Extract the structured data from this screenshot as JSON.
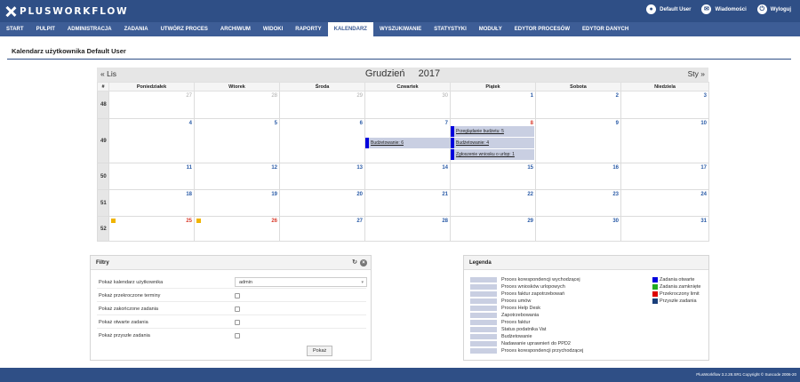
{
  "app": {
    "logo": "PLUSWORKFLOW"
  },
  "user_links": [
    {
      "label": "Default User",
      "icon": "user-icon",
      "glyph": "●"
    },
    {
      "label": "Wiadomości",
      "icon": "mail-icon",
      "glyph": "✉"
    },
    {
      "label": "Wyloguj",
      "icon": "power-icon",
      "glyph": "⏻"
    }
  ],
  "nav": [
    "START",
    "PULPIT",
    "ADMINISTRACJA",
    "ZADANIA",
    "UTWÓRZ PROCES",
    "ARCHIWUM",
    "WIDOKI",
    "RAPORTY",
    "KALENDARZ",
    "WYSZUKIWANIE",
    "STATYSTYKI",
    "MODUŁY",
    "EDYTOR PROCESÓW",
    "EDYTOR DANYCH"
  ],
  "active_nav": "KALENDARZ",
  "page_title": "Kalendarz użytkownika Default User",
  "calendar": {
    "prev": "« Lis",
    "next": "Sty »",
    "month": "Grudzień",
    "year": "2017",
    "headers": [
      "#",
      "Poniedziałek",
      "Wtorek",
      "Środa",
      "Czwartek",
      "Piątek",
      "Sobota",
      "Niedziela"
    ],
    "weeks": [
      {
        "num": "48",
        "days": [
          "27",
          "28",
          "29",
          "30",
          "1",
          "2",
          "3"
        ]
      },
      {
        "num": "49",
        "days": [
          "4",
          "5",
          "6",
          "7",
          "8",
          "9",
          "10"
        ]
      },
      {
        "num": "50",
        "days": [
          "11",
          "12",
          "13",
          "14",
          "15",
          "16",
          "17"
        ]
      },
      {
        "num": "51",
        "days": [
          "18",
          "19",
          "20",
          "21",
          "22",
          "23",
          "24"
        ]
      },
      {
        "num": "52",
        "days": [
          "25",
          "26",
          "27",
          "28",
          "29",
          "30",
          "31"
        ]
      }
    ],
    "events": {
      "budzetowanie_6": "Budżetowanie: 6",
      "przegladanie_5": "Przeglądanie budżetu: 5",
      "budzetowanie_4": "Budżetowanie: 4",
      "urlop_1": "Zgłoszenie wniosku o urlop: 1"
    },
    "event_color": "#0000dd"
  },
  "filters": {
    "title": "Filtry",
    "calendar_label": "Pokaż kalendarz użytkownika",
    "calendar_value": "admin",
    "overdue_label": "Pokaż przekroczone terminy",
    "finished_label": "Pokaż zakończone zadania",
    "open_label": "Pokaż otwarte zadania",
    "future_label": "Pokaż przyszłe zadania",
    "show_button": "Pokaż"
  },
  "legend": {
    "title": "Legenda",
    "processes": [
      "Proces korespondencji wychodzącej",
      "Proces wniosków urlopowych",
      "Proces faktur zapotrzebowań",
      "Proces umów",
      "Proces Help Desk",
      "Zapotrzebowania",
      "Proces faktur",
      "Status podatnika Vat",
      "Budżetowanie",
      "Nadawanie uprawnień do PPD2",
      "Proces korespondencji przychodzącej"
    ],
    "statuses": [
      {
        "label": "Zadania otwarte",
        "color": "#0000dd"
      },
      {
        "label": "Zadania zamknięte",
        "color": "#22aa22"
      },
      {
        "label": "Przekroczony limit",
        "color": "#dd0000"
      },
      {
        "label": "Przyszłe zadania",
        "color": "#1a3f7a"
      }
    ]
  },
  "footer": "PlusWorkflow 3.2.28.SR1 Copyright © Suncode 2006-20"
}
